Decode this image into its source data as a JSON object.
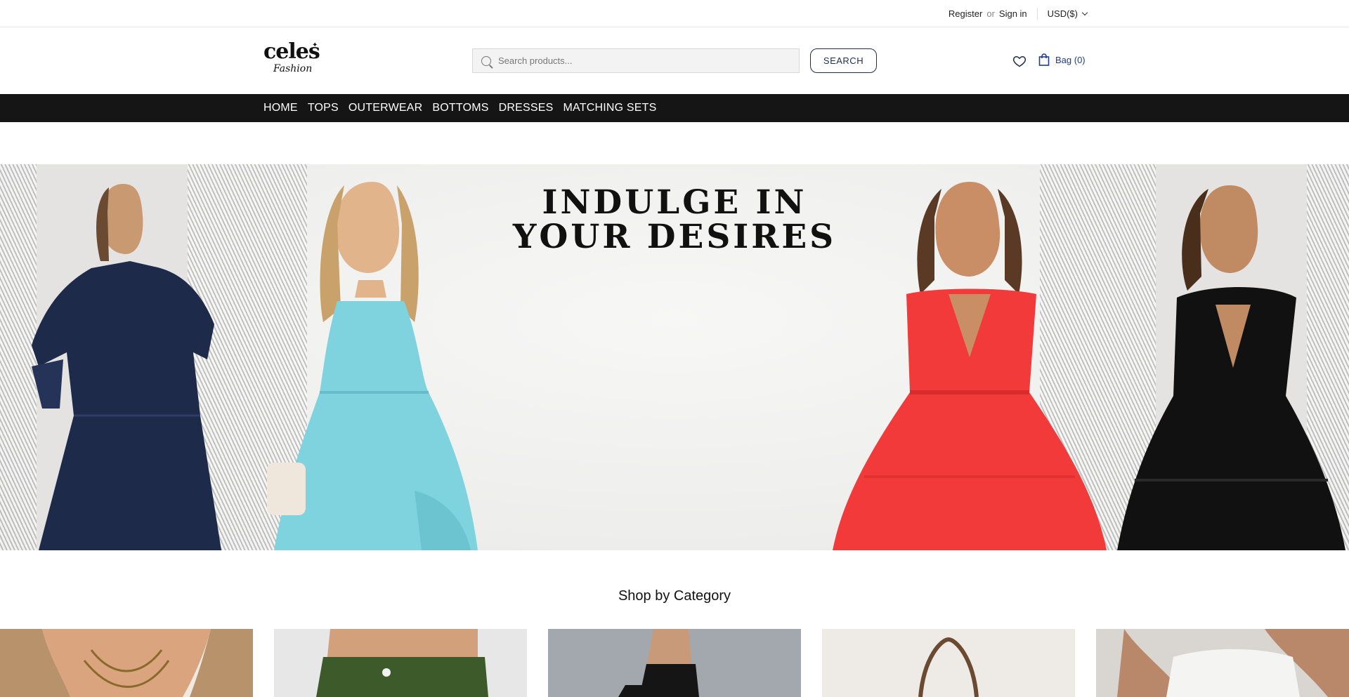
{
  "topbar": {
    "register": "Register",
    "or": "or",
    "sign_in": "Sign in",
    "currency": "USD($)"
  },
  "header": {
    "logo_line1": "celes",
    "logo_line2": "Fashion",
    "search_placeholder": "Search products...",
    "search_button": "SEARCH",
    "bag_label": "Bag (0)"
  },
  "nav": {
    "items": [
      "HOME",
      "TOPS",
      "OUTERWEAR",
      "BOTTOMS",
      "DRESSES",
      "MATCHING SETS"
    ]
  },
  "hero": {
    "title_line1": "INDULGE IN",
    "title_line2": "YOUR DESIRES",
    "dress_colors": [
      "#1e2a4a",
      "#7fd3df",
      "#f23a3a",
      "#111111"
    ]
  },
  "category": {
    "title": "Shop by Category"
  },
  "colors": {
    "nav_bg": "#151515",
    "accent_navy": "#1f2f4a",
    "bag_blue": "#1f3d8a"
  }
}
